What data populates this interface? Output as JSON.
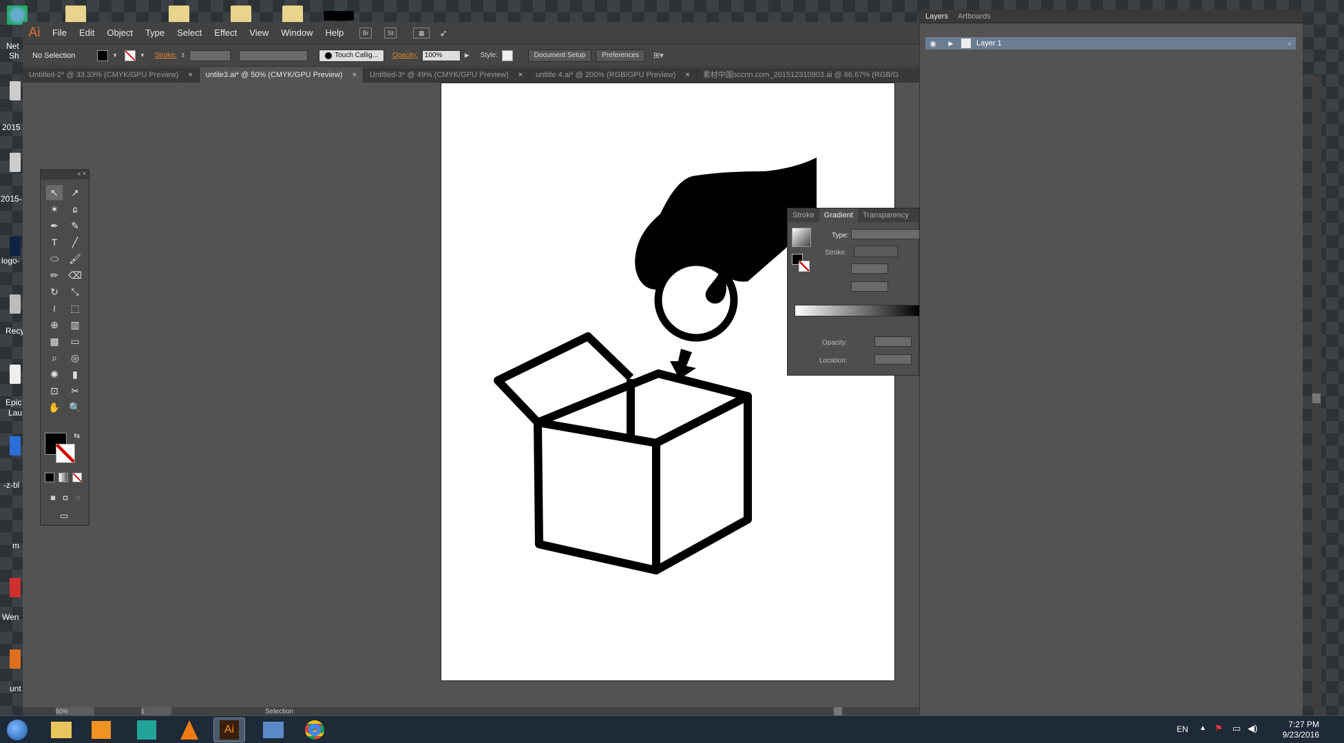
{
  "desktop": {
    "labels": [
      "Net",
      "Sh",
      "2015",
      "2015-",
      "logo-",
      "Recy",
      "Epic",
      "Lau",
      "-z-bl",
      "m",
      "Wen",
      "unt"
    ]
  },
  "app": {
    "logo": "Ai",
    "menu": [
      "File",
      "Edit",
      "Object",
      "Type",
      "Select",
      "Effect",
      "View",
      "Window",
      "Help"
    ],
    "br": "Br",
    "st": "St"
  },
  "control": {
    "selection": "No Selection",
    "stroke_label": "Stroke:",
    "brush": "Touch Callig...",
    "opacity_label": "Opacity:",
    "opacity_value": "100%",
    "style_label": "Style:",
    "doc_setup": "Document Setup",
    "preferences": "Preferences"
  },
  "tabs": [
    {
      "label": "Untitled-2* @ 33.33% (CMYK/GPU Preview)",
      "active": false
    },
    {
      "label": "untile3.ai* @ 50% (CMYK/GPU Preview)",
      "active": true
    },
    {
      "label": "Untitled-3* @ 49% (CMYK/GPU Preview)",
      "active": false
    },
    {
      "label": "untitle 4.ai* @ 200% (RGB/GPU Preview)",
      "active": false
    },
    {
      "label": "素材中国sccnn.com_201512310903.ai @ 66.67% (RGB/G",
      "active": false
    }
  ],
  "layers": {
    "tab_layers": "Layers",
    "tab_artboards": "Artboards",
    "layer_name": "Layer 1"
  },
  "gradient": {
    "tabs": [
      "Stroke",
      "Gradient",
      "Transparency"
    ],
    "type_label": "Type:",
    "stroke_label": "Stroke:",
    "opacity_label": "Opacity:",
    "location_label": "Location:"
  },
  "status": {
    "zoom": "50%",
    "page": "1",
    "tool": "Selection"
  },
  "taskbar": {
    "lang": "EN",
    "time": "7:27 PM",
    "date": "9/23/2016"
  },
  "colors": {
    "accent": "#e0762f",
    "selection": "#6b7d92"
  }
}
